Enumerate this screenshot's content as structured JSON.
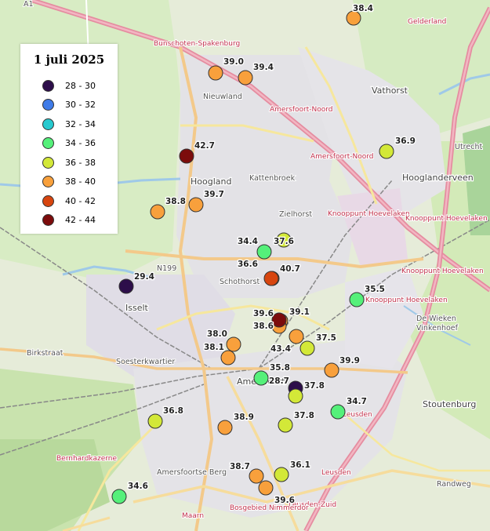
{
  "map": {
    "legend": {
      "title": "1 juli 2025",
      "classes": [
        {
          "label": "28 - 30",
          "color": "#2d0e4a"
        },
        {
          "label": "30 - 32",
          "color": "#3f7be8"
        },
        {
          "label": "32 - 34",
          "color": "#27c9cf"
        },
        {
          "label": "34 - 36",
          "color": "#55f07a"
        },
        {
          "label": "36 - 38",
          "color": "#d3e838"
        },
        {
          "label": "38 - 40",
          "color": "#f8a03c"
        },
        {
          "label": "40 - 42",
          "color": "#d7450f"
        },
        {
          "label": "42 - 44",
          "color": "#7c0c0c"
        }
      ]
    },
    "measurements": [
      {
        "label": "38.4",
        "value": 38.4
      },
      {
        "label": "39.0",
        "value": 39.0
      },
      {
        "label": "39.4",
        "value": 39.4
      },
      {
        "label": "36.9",
        "value": 36.9
      },
      {
        "label": "42.7",
        "value": 42.7
      },
      {
        "label": "39.7",
        "value": 39.7
      },
      {
        "label": "38.8",
        "value": 38.8
      },
      {
        "label": "34.4",
        "value": 34.4
      },
      {
        "label": "37.6",
        "value": 37.6
      },
      {
        "label": "36.6",
        "value": 36.6
      },
      {
        "label": "40.7",
        "value": 40.7
      },
      {
        "label": "29.4",
        "value": 29.4
      },
      {
        "label": "35.5",
        "value": 35.5
      },
      {
        "label": "39.6",
        "value": 39.6
      },
      {
        "label": "38.6",
        "value": 38.6
      },
      {
        "label": "39.1",
        "value": 39.1
      },
      {
        "label": "38.0",
        "value": 38.0
      },
      {
        "label": "38.1",
        "value": 38.1
      },
      {
        "label": "43.4",
        "value": 43.4
      },
      {
        "label": "37.5",
        "value": 37.5
      },
      {
        "label": "39.9",
        "value": 39.9
      },
      {
        "label": "35.8",
        "value": 35.8
      },
      {
        "label": "28.7",
        "value": 28.7
      },
      {
        "label": "37.8",
        "value": 37.8
      },
      {
        "label": "36.8",
        "value": 36.8
      },
      {
        "label": "34.7",
        "value": 34.7
      },
      {
        "label": "38.9",
        "value": 38.9
      },
      {
        "label": "37.8",
        "value": 37.8
      },
      {
        "label": "38.7",
        "value": 38.7
      },
      {
        "label": "36.1",
        "value": 36.1
      },
      {
        "label": "39.6",
        "value": 39.6
      },
      {
        "label": "34.6",
        "value": 34.6
      }
    ],
    "place_labels": [
      "Bunschoten-Spakenburg",
      "Nieuwland",
      "Amersfoort-Noord",
      "Vathorst",
      "Amersfoort-Noord",
      "Hoogland",
      "Kattenbroek",
      "Hooglanderveen",
      "Zielhorst",
      "Knooppunt Hoevelaken",
      "Knooppunt Hoevelaken",
      "Knooppunt Hoevelaken",
      "Schothorst",
      "Isselt",
      "N199",
      "Knooppunt Hoevelaken",
      "De Wieken",
      "Vinkenhoef",
      "Soesterkwartier",
      "Birkstraat",
      "Amersfoort",
      "Stoutenburg",
      "Leusden",
      "Bernhardkazerne",
      "Amersfoortse Berg",
      "Leusden",
      "Leusden-Zuid",
      "Bosgebied Nimmerdor",
      "Maarn",
      "Randweg",
      "A1",
      "Gelderland",
      "Utrecht"
    ]
  }
}
